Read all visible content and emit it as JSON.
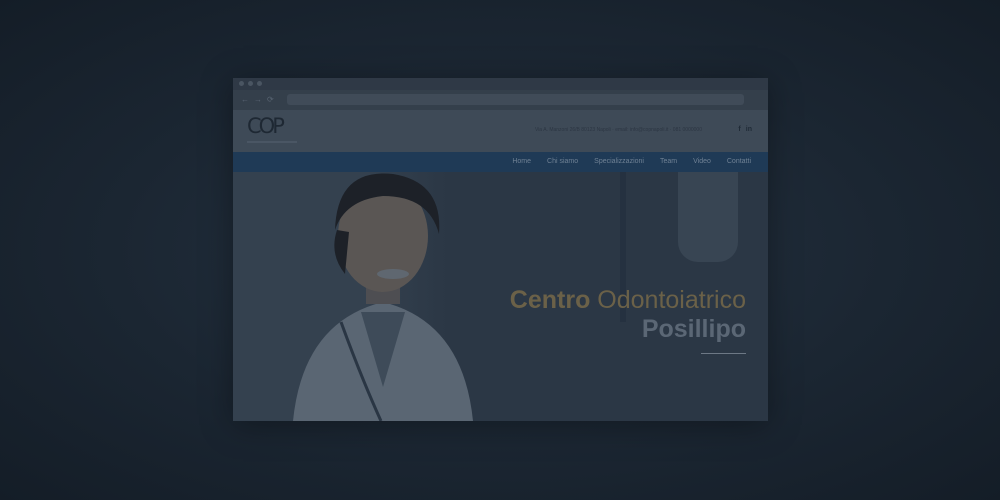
{
  "browser": {
    "tab_title": "",
    "nav_back": "←",
    "nav_forward": "→",
    "nav_reload": "⟳"
  },
  "site": {
    "logo_text": "COP",
    "contact_line": "Via A. Manzoni 26/B 80123 Napoli · email: info@copnapoli.it · 081 0000000",
    "social": {
      "facebook": "f",
      "linkedin": "in"
    },
    "nav": [
      "Home",
      "Chi siamo",
      "Specializzazioni",
      "Team",
      "Video",
      "Contatti"
    ]
  },
  "hero": {
    "headline_bold": "Centro",
    "headline_light": "Odontoiatrico",
    "headline_line2": "Posillipo"
  },
  "colors": {
    "backdrop": "#1b2632",
    "nav_strip": "#1f3a56",
    "headline_gold": "#6b6148",
    "header_bg": "#3e4a57"
  }
}
